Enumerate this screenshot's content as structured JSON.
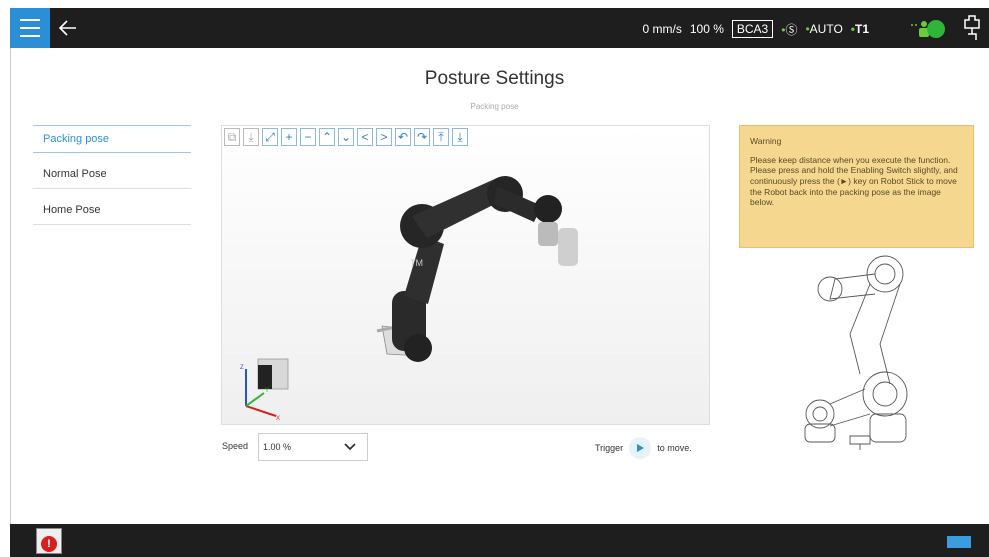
{
  "topbar": {
    "speed_mm": "0 mm/s",
    "speed_pct": "100 %",
    "project": "BCA3",
    "safety": "Ⓢ",
    "mode": "AUTO",
    "operation": "T1"
  },
  "page": {
    "title": "Posture Settings",
    "subtitle": "Packing pose"
  },
  "sidebar": {
    "items": [
      {
        "label": "Packing pose"
      },
      {
        "label": "Normal Pose"
      },
      {
        "label": "Home Pose"
      }
    ]
  },
  "viewer": {
    "toolbar": [
      "⧉",
      "⤓",
      "⤢",
      "+",
      "−",
      "⌃",
      "⌄",
      "<",
      ">",
      "↶",
      "↷",
      "⤒",
      "⤓"
    ],
    "robot_logo": "TM",
    "axes": {
      "x": "X",
      "y": "Y",
      "z": "Z"
    }
  },
  "controls": {
    "speed_label": "Speed",
    "speed_value": "1.00 %",
    "trigger_label": "Trigger",
    "to_move_label": "to move."
  },
  "warning": {
    "title": "Warning",
    "line1": "Please keep distance when you execute the function.",
    "line2": "Please press and hold the Enabling Switch slightly, and continuously press the (►) key on Robot Stick to move the Robot back into the packing pose as the image below."
  },
  "colors": {
    "accent": "#2c8fd6",
    "warning_bg": "#f5d790",
    "topbar_bg": "#1e1e1e",
    "status_green": "#2fb53a"
  },
  "icons": {
    "menu": "hamburger-icon",
    "back": "arrow-left-icon",
    "robot": "robot-status-icon",
    "plug": "plug-icon",
    "error": "error-icon",
    "keyboard": "keyboard-icon",
    "play": "play-icon"
  }
}
